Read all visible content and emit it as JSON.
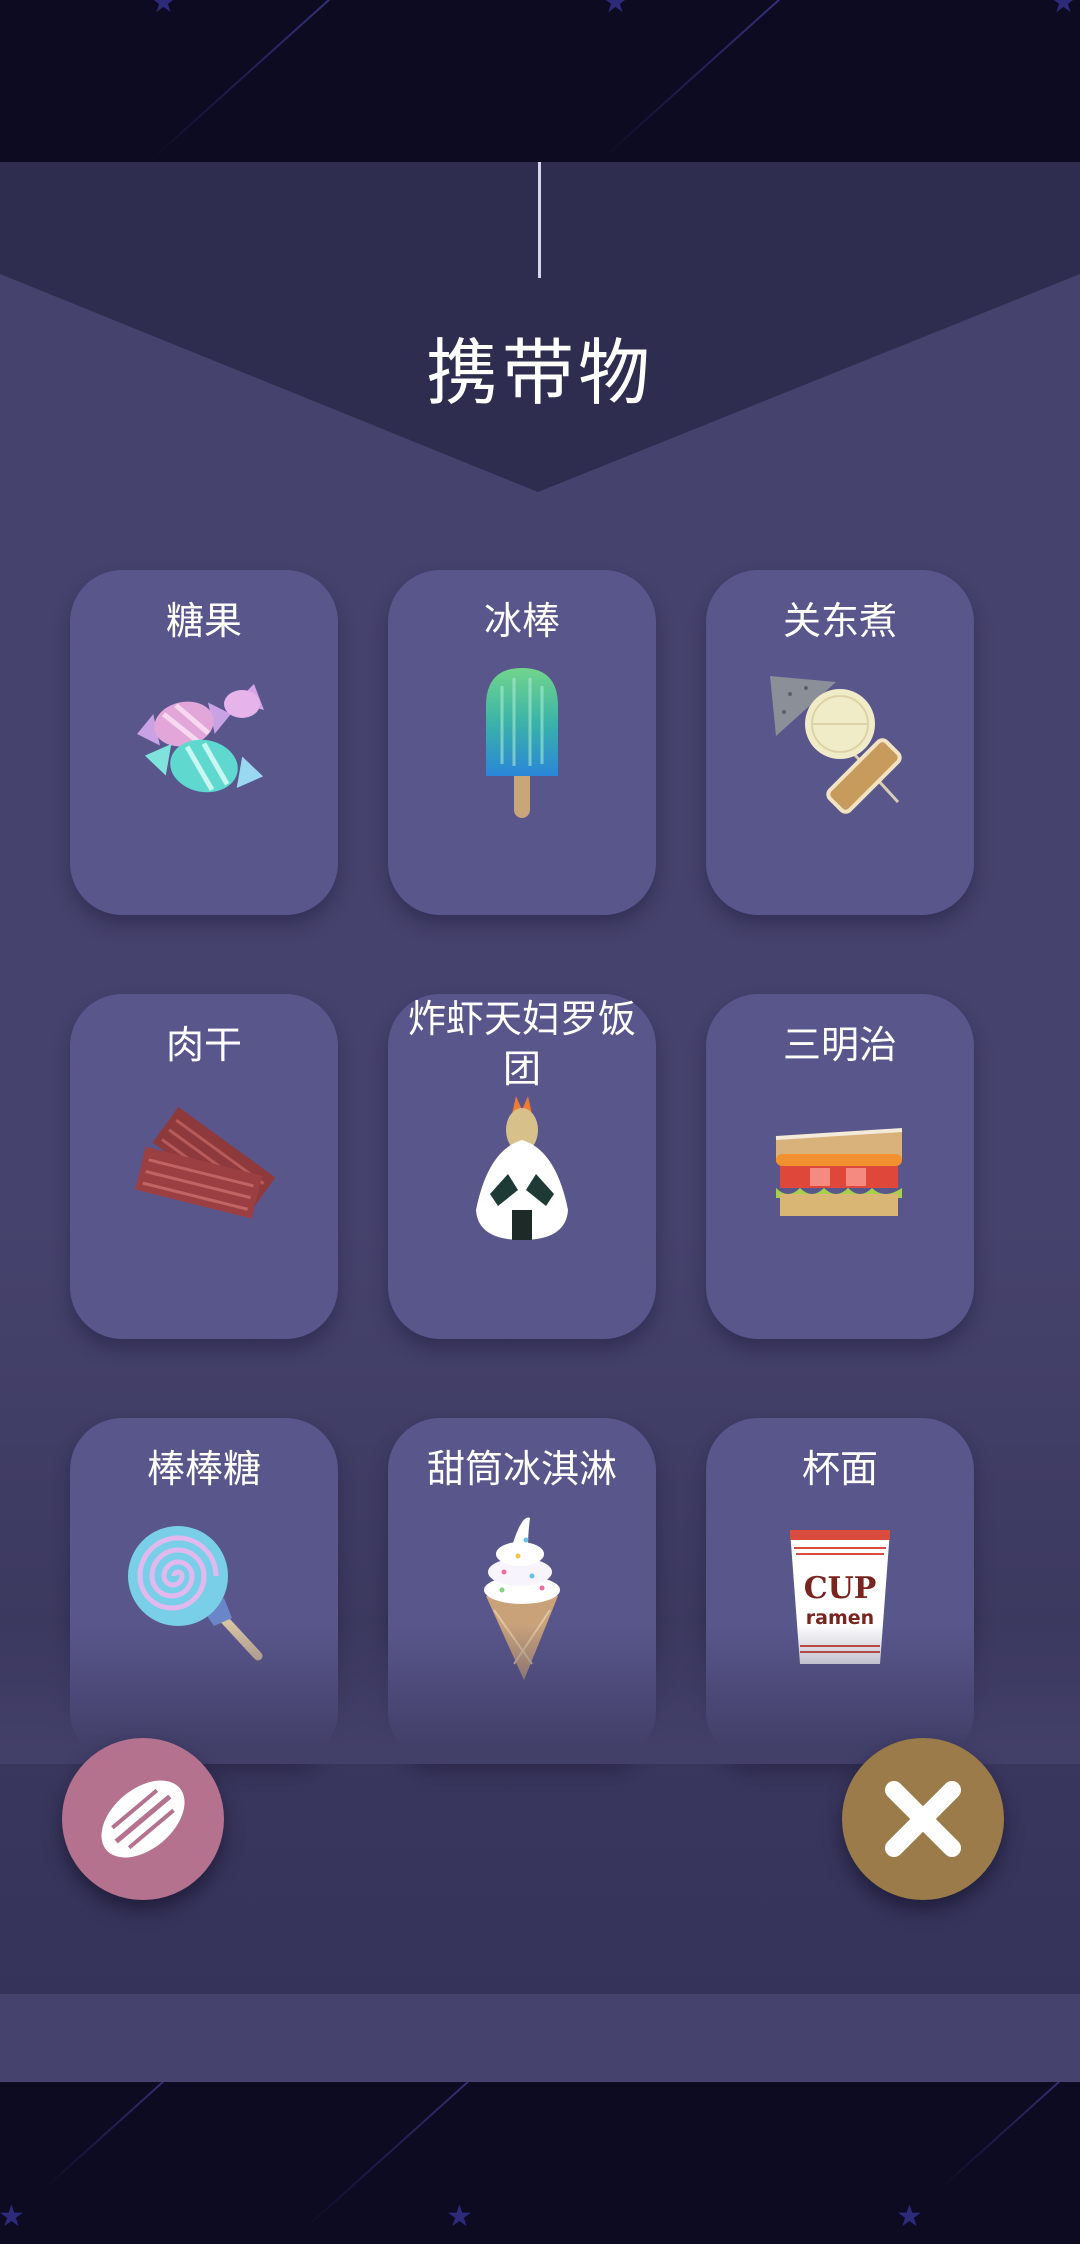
{
  "title": "携带物",
  "items": [
    {
      "name": "糖果",
      "icon": "candy-icon"
    },
    {
      "name": "冰棒",
      "icon": "popsicle-icon"
    },
    {
      "name": "关东煮",
      "icon": "oden-icon"
    },
    {
      "name": "肉干",
      "icon": "jerky-icon"
    },
    {
      "name": "炸虾天妇罗饭团",
      "icon": "tempura-onigiri-icon"
    },
    {
      "name": "三明治",
      "icon": "sandwich-icon"
    },
    {
      "name": "棒棒糖",
      "icon": "lollipop-icon"
    },
    {
      "name": "甜筒冰淇淋",
      "icon": "ice-cream-cone-icon"
    },
    {
      "name": "杯面",
      "icon": "cup-ramen-icon",
      "cup_text": "CUP",
      "cup_subtext": "ramen"
    }
  ],
  "buttons": {
    "left_icon": "seed-icon",
    "right_icon": "close-icon"
  },
  "colors": {
    "panel": "#45426d",
    "card": "#59568c",
    "seed_button": "#b4728f",
    "close_button": "#9a7b49",
    "sky": "#0c0b22"
  }
}
